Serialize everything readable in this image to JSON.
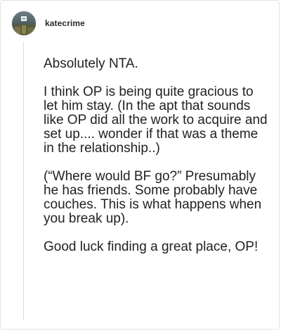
{
  "post": {
    "username": "katecrime",
    "avatar_icon": "avatar-icon",
    "paragraphs": [
      "Absolutely NTA.",
      "I think OP is being quite gracious to let him stay. (In the apt that sounds like OP did all the work to acquire and set up.... wonder if that was a theme in the relationship..)",
      "(“Where would BF go?” Presumably he has friends. Some probably have couches. This is what happens when you break up).",
      "Good luck finding a great place, OP!"
    ]
  },
  "colors": {
    "border": "#e3e3e3",
    "thread_line": "#dcdcdc",
    "text": "#222222"
  }
}
